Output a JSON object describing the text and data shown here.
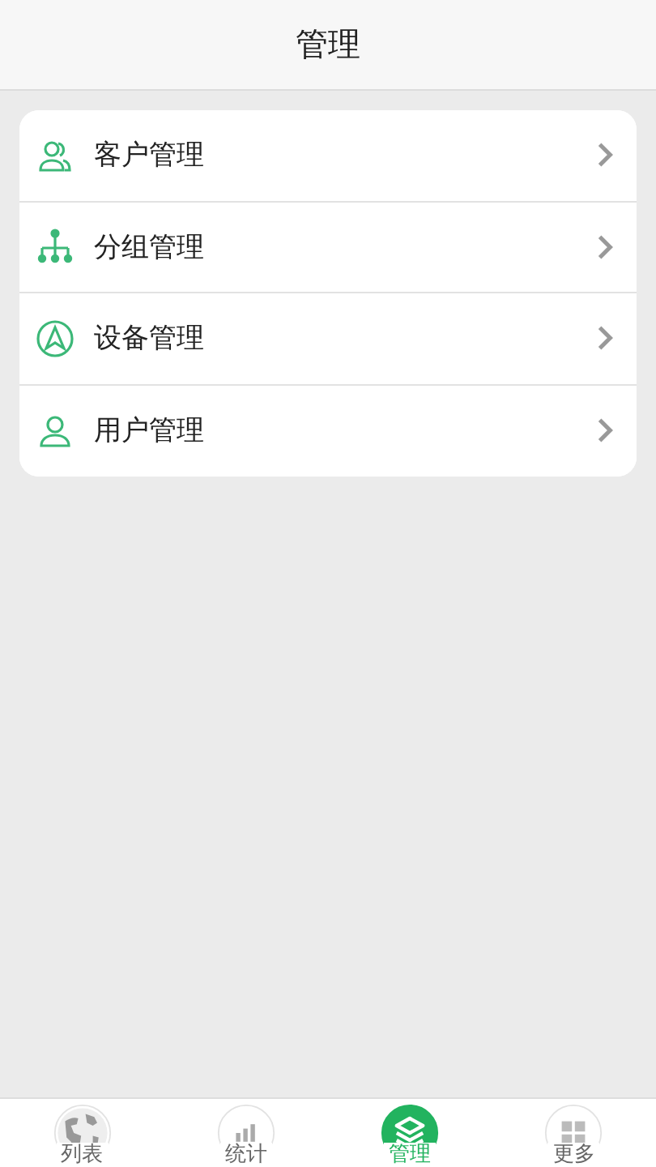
{
  "header": {
    "title": "管理"
  },
  "menu": [
    {
      "label": "客户管理"
    },
    {
      "label": "分组管理"
    },
    {
      "label": "设备管理"
    },
    {
      "label": "用户管理"
    }
  ],
  "tabs": [
    {
      "label": "列表",
      "selected": false
    },
    {
      "label": "统计",
      "selected": false
    },
    {
      "label": "管理",
      "selected": true
    },
    {
      "label": "更多",
      "selected": false
    }
  ]
}
